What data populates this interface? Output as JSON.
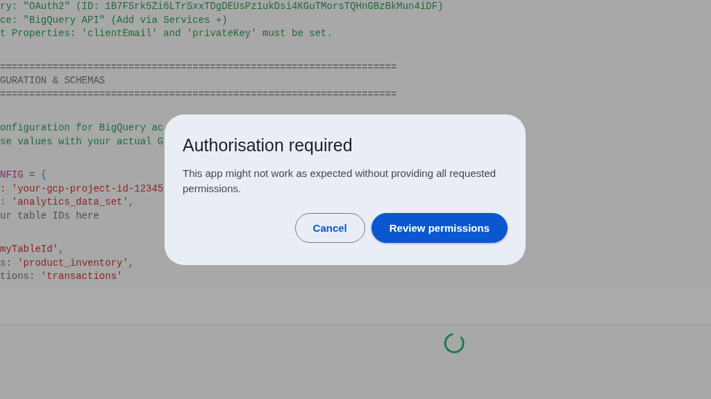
{
  "code_blocks": [
    {
      "lines": [
        [
          {
            "kind": "doc",
            "text": "ry: \"OAuth2\" (ID: 1B7FSrk5Zi6LTrSxxTDgDEUsPz1ukDsi4KGuTMorsTQHnGBzBkMun4iDF)"
          }
        ],
        [
          {
            "kind": "doc",
            "text": "ce: \"BigQuery API\" (Add via Services +)"
          }
        ],
        [
          {
            "kind": "doc",
            "text": "t Properties: 'clientEmail' and 'privateKey' must be set."
          }
        ]
      ]
    },
    {
      "lines": [
        [
          {
            "kind": "comment",
            "text": "===================================================================="
          }
        ],
        [
          {
            "kind": "comment",
            "text": "GURATION & SCHEMAS"
          }
        ],
        [
          {
            "kind": "comment",
            "text": "===================================================================="
          }
        ]
      ]
    },
    {
      "lines": [
        [
          {
            "kind": "doc",
            "text": "onfiguration for BigQuery ac"
          }
        ],
        [
          {
            "kind": "doc",
            "text": "se values with your actual G"
          }
        ]
      ]
    },
    {
      "lines": [
        [
          {
            "kind": "keyword",
            "text": "NFIG"
          },
          {
            "kind": "plain",
            "text": " = "
          },
          {
            "kind": "brace",
            "text": "{"
          }
        ],
        [
          {
            "kind": "plain",
            "text": ": "
          },
          {
            "kind": "string",
            "text": "'your-gcp-project-id-12345"
          }
        ],
        [
          {
            "kind": "plain",
            "text": ": "
          },
          {
            "kind": "string",
            "text": "'analytics_data_set'"
          },
          {
            "kind": "plain",
            "text": ","
          }
        ],
        [
          {
            "kind": "comment",
            "text": "ur table IDs here"
          }
        ]
      ]
    },
    {
      "lines": [
        [
          {
            "kind": "string",
            "text": "myTableId'"
          },
          {
            "kind": "plain",
            "text": ","
          }
        ],
        [
          {
            "kind": "plain",
            "text": "s: "
          },
          {
            "kind": "string",
            "text": "'product_inventory'"
          },
          {
            "kind": "plain",
            "text": ","
          }
        ],
        [
          {
            "kind": "plain",
            "text": "tions: "
          },
          {
            "kind": "string",
            "text": "'transactions'"
          }
        ]
      ]
    }
  ],
  "dialog": {
    "title": "Authorisation required",
    "message": "This app might not work as expected without providing all requested permissions.",
    "buttons": [
      {
        "label": "Cancel",
        "kind": "outlined"
      },
      {
        "label": "Review permissions",
        "kind": "filled"
      }
    ]
  },
  "loading": true
}
